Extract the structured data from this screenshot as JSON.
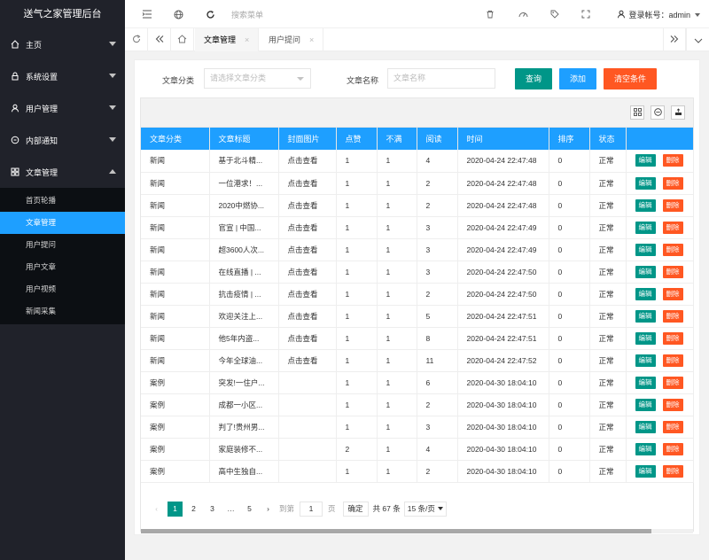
{
  "brand": "送气之家管理后台",
  "sidebar": {
    "items": [
      {
        "label": "主页",
        "icon": "home-icon"
      },
      {
        "label": "系统设置",
        "icon": "lock-icon"
      },
      {
        "label": "用户管理",
        "icon": "user-icon"
      },
      {
        "label": "内部通知",
        "icon": "clock-icon"
      },
      {
        "label": "文章管理",
        "icon": "grid-icon"
      }
    ],
    "sub_items": [
      "首页轮播",
      "文章管理",
      "用户提问",
      "用户文章",
      "用户视频",
      "新闻采集"
    ]
  },
  "header": {
    "search_placeholder": "搜索菜单",
    "user_label": "登录帐号：admin"
  },
  "tabs": [
    {
      "label": "文章管理",
      "close": "×"
    },
    {
      "label": "用户提问",
      "close": "×"
    }
  ],
  "filters": {
    "category_label": "文章分类",
    "category_placeholder": "请选择文章分类",
    "name_label": "文章名称",
    "name_placeholder": "文章名称",
    "query_button": "查询",
    "add_button": "添加",
    "clear_button": "清空条件"
  },
  "colors": {
    "accent": "#1e9fff",
    "teal": "#009688",
    "orange": "#ff5722",
    "sidebar_bg": "#20222a"
  },
  "table": {
    "headers": [
      "文章分类",
      "文章标题",
      "封面图片",
      "点赞",
      "不满",
      "阅读",
      "时间",
      "排序",
      "状态",
      ""
    ],
    "edit_label": "编辑",
    "delete_label": "删除",
    "rows": [
      [
        "新闻",
        "基于北斗精...",
        "点击查看",
        "1",
        "1",
        "4",
        "2020-04-24 22:47:48",
        "0",
        "正常"
      ],
      [
        "新闻",
        "一位港求！...",
        "点击查看",
        "1",
        "1",
        "2",
        "2020-04-24 22:47:48",
        "0",
        "正常"
      ],
      [
        "新闻",
        "2020中燃协...",
        "点击查看",
        "1",
        "1",
        "2",
        "2020-04-24 22:47:48",
        "0",
        "正常"
      ],
      [
        "新闻",
        "官宣 | 中国...",
        "点击查看",
        "1",
        "1",
        "3",
        "2020-04-24 22:47:49",
        "0",
        "正常"
      ],
      [
        "新闻",
        "超3600人次...",
        "点击查看",
        "1",
        "1",
        "3",
        "2020-04-24 22:47:49",
        "0",
        "正常"
      ],
      [
        "新闻",
        "在线直播 | ...",
        "点击查看",
        "1",
        "1",
        "3",
        "2020-04-24 22:47:50",
        "0",
        "正常"
      ],
      [
        "新闻",
        "抗击疫情 | ...",
        "点击查看",
        "1",
        "1",
        "2",
        "2020-04-24 22:47:50",
        "0",
        "正常"
      ],
      [
        "新闻",
        "欢迎关注上...",
        "点击查看",
        "1",
        "1",
        "5",
        "2020-04-24 22:47:51",
        "0",
        "正常"
      ],
      [
        "新闻",
        "他5年内盗...",
        "点击查看",
        "1",
        "1",
        "8",
        "2020-04-24 22:47:51",
        "0",
        "正常"
      ],
      [
        "新闻",
        "今年全球油...",
        "点击查看",
        "1",
        "1",
        "11",
        "2020-04-24 22:47:52",
        "0",
        "正常"
      ],
      [
        "案例",
        "突发!一住户...",
        "",
        "1",
        "1",
        "6",
        "2020-04-30 18:04:10",
        "0",
        "正常"
      ],
      [
        "案例",
        "成都一小区...",
        "",
        "1",
        "1",
        "2",
        "2020-04-30 18:04:10",
        "0",
        "正常"
      ],
      [
        "案例",
        "判了!贵州男...",
        "",
        "1",
        "1",
        "3",
        "2020-04-30 18:04:10",
        "0",
        "正常"
      ],
      [
        "案例",
        "家庭装修不...",
        "",
        "2",
        "1",
        "4",
        "2020-04-30 18:04:10",
        "0",
        "正常"
      ],
      [
        "案例",
        "高中生独自...",
        "",
        "1",
        "1",
        "2",
        "2020-04-30 18:04:10",
        "0",
        "正常"
      ]
    ]
  },
  "pagination": {
    "prev": "‹",
    "pages": [
      "1",
      "2",
      "3",
      "…",
      "5"
    ],
    "next": "›",
    "goto_label": "到第",
    "goto_value": "1",
    "page_unit": "页",
    "confirm": "确定",
    "total": "共 67 条",
    "page_size": "15 条/页"
  }
}
